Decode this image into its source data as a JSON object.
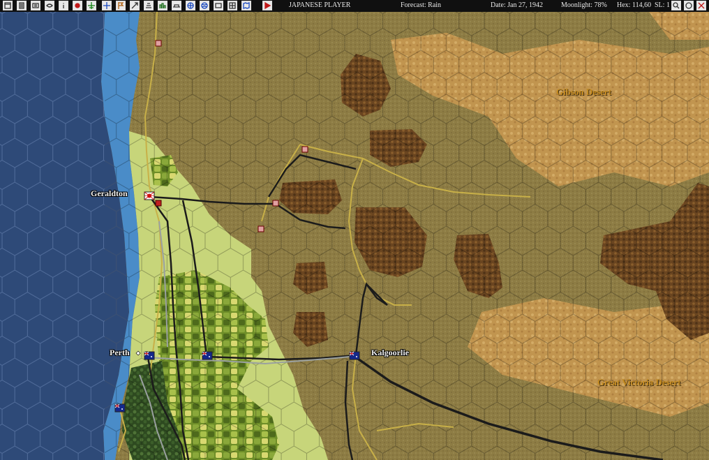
{
  "toolbar": {
    "player": "JAPANESE PLAYER",
    "forecast": "Forecast: Rain",
    "date": "Date: Jan 27, 1942",
    "moonlight": "Moonlight: 78%",
    "hex": "Hex: 114,60",
    "sl": "SL: 1",
    "buttons": [
      {
        "icon": "window-icon",
        "color": "#303030"
      },
      {
        "icon": "report-icon",
        "color": "#303030"
      },
      {
        "icon": "base-list-icon",
        "color": "#303030"
      },
      {
        "icon": "ship-list-icon",
        "color": "#303030"
      },
      {
        "icon": "info-icon",
        "color": "#303030"
      },
      {
        "icon": "japan-flag-icon",
        "color": "#c01818"
      },
      {
        "icon": "air-group-icon",
        "color": "#108010"
      },
      {
        "icon": "fleet-icon",
        "color": "#1848c0"
      },
      {
        "icon": "flag-icon",
        "color": "#b06010"
      },
      {
        "icon": "move-icon",
        "color": "#303030"
      },
      {
        "icon": "transfer-icon",
        "color": "#303030"
      },
      {
        "icon": "production-icon",
        "color": "#207020"
      },
      {
        "icon": "convoy-icon",
        "color": "#303030"
      },
      {
        "icon": "globe-icon",
        "color": "#1848c0"
      },
      {
        "icon": "earth-icon",
        "color": "#1848c0"
      },
      {
        "icon": "ops-icon",
        "color": "#303030"
      },
      {
        "icon": "grid-icon",
        "color": "#303030"
      },
      {
        "icon": "map-icon",
        "color": "#1848c0"
      },
      {
        "icon": "play-turn-icon",
        "color": "#c01818"
      }
    ],
    "right_buttons": [
      {
        "icon": "zoom-icon",
        "color": "#303030"
      },
      {
        "icon": "center-icon",
        "color": "#303030"
      },
      {
        "icon": "close-icon",
        "color": "#c01818"
      }
    ]
  },
  "map": {
    "cities": [
      {
        "name": "Geraldton",
        "flag": "japan"
      },
      {
        "name": "Perth",
        "flag": "australia"
      },
      {
        "name": "Kalgoorlie",
        "flag": "australia"
      }
    ],
    "regions": [
      "Gibson Desert",
      "Great Victoria Desert"
    ],
    "colors": {
      "ocean": "#2e4a78",
      "shallow": "#4a8cc8",
      "land": "#8e7d44",
      "coastal": "#c9d87a",
      "farmland": "#7a9a30",
      "desert": "#c99a58",
      "hills": "#6e4a22",
      "road": "#c8b048",
      "rail": "#1a1a1a"
    }
  }
}
